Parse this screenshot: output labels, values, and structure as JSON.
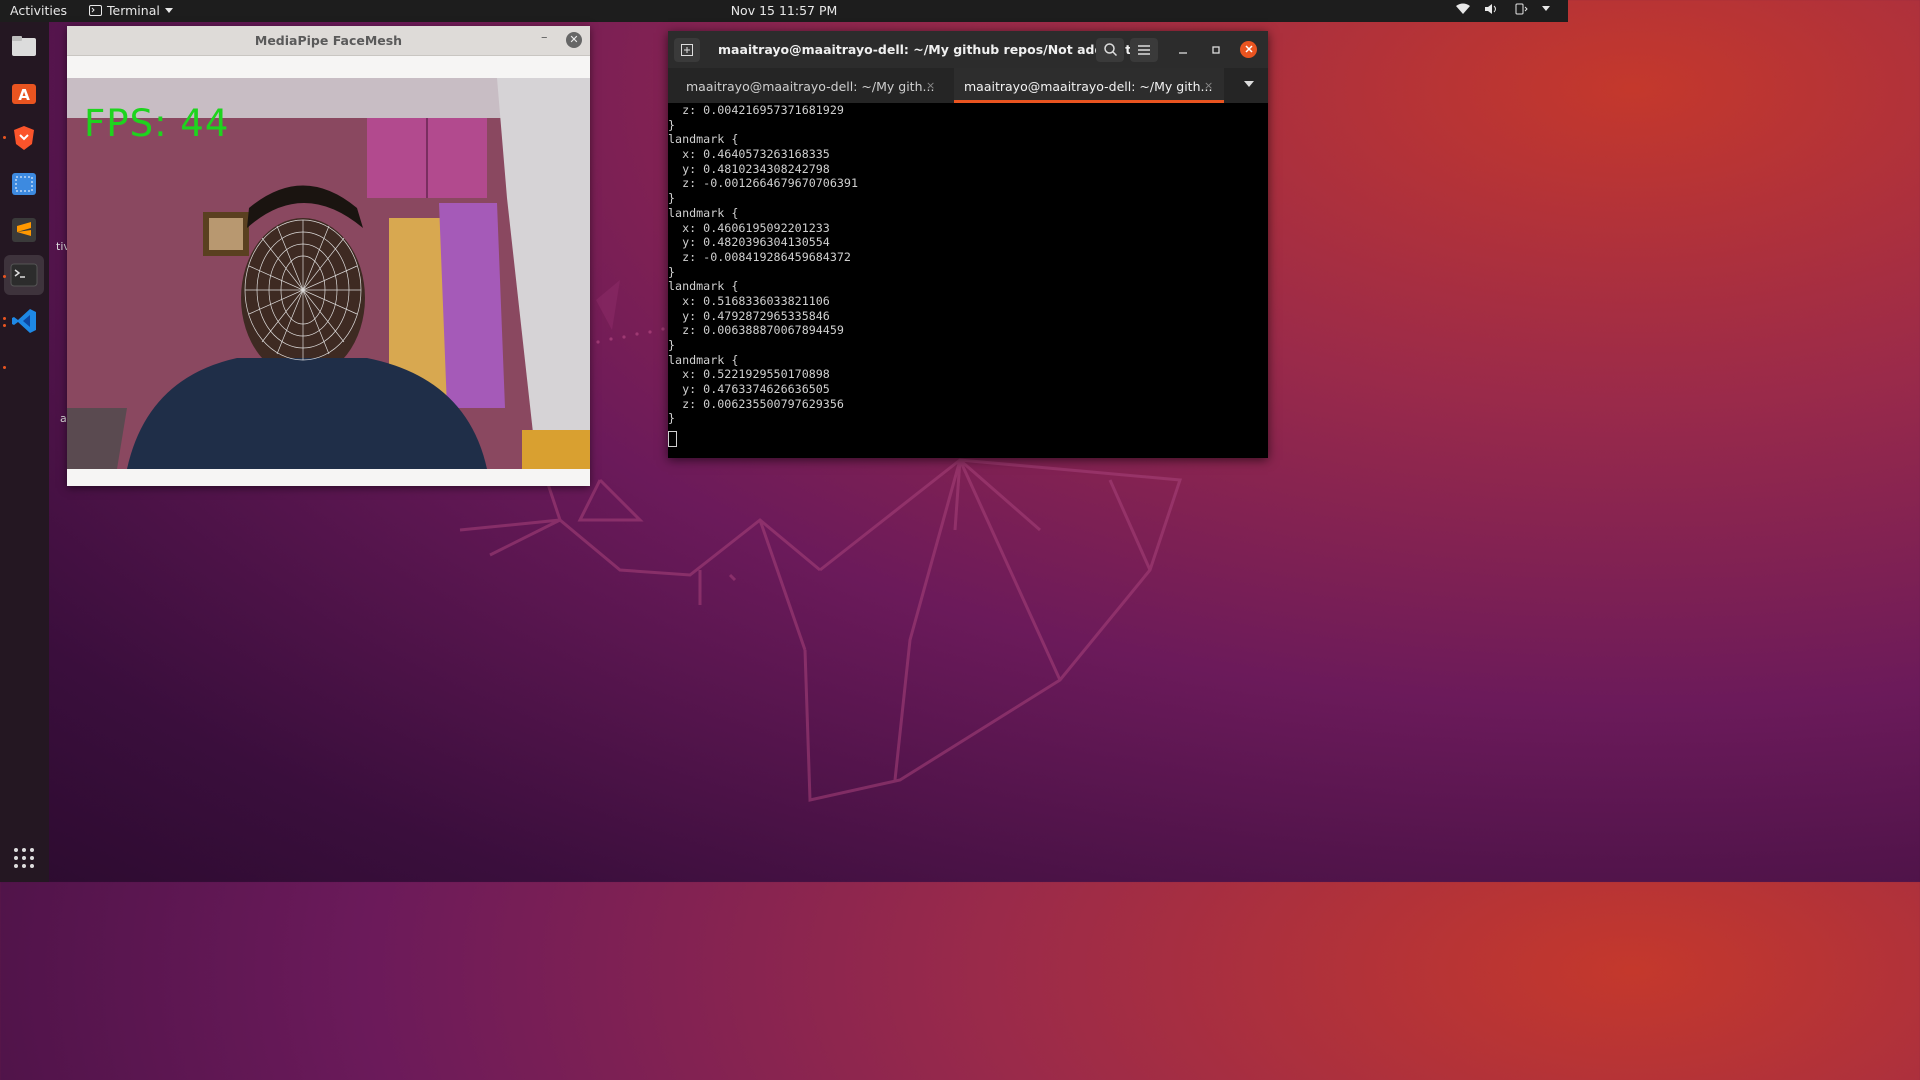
{
  "topbar": {
    "activities": "Activities",
    "app_menu": "Terminal",
    "clock": "Nov 15  11:57 PM"
  },
  "desktop": {
    "partial_label_1": "tiv",
    "partial_label_2": "a"
  },
  "dock": {
    "items": [
      {
        "name": "files-icon"
      },
      {
        "name": "software-icon"
      },
      {
        "name": "brave-browser-icon"
      },
      {
        "name": "screenshot-icon"
      },
      {
        "name": "sublime-text-icon"
      },
      {
        "name": "terminal-icon"
      },
      {
        "name": "vscode-icon"
      },
      {
        "name": "show-apps-icon"
      }
    ]
  },
  "facemesh_window": {
    "title": "MediaPipe FaceMesh",
    "minimize": "–",
    "close": "✕",
    "fps_text": "FPS: 44"
  },
  "terminal": {
    "title": "maaitrayo@maaitrayo-dell: ~/My github repos/Not added to...",
    "tabs": [
      {
        "label": "maaitrayo@maaitrayo-dell: ~/My gith...",
        "active": false
      },
      {
        "label": "maaitrayo@maaitrayo-dell: ~/My gith...",
        "active": true
      }
    ],
    "tab_close": "×",
    "lines": [
      "  z: 0.004216957371681929",
      "}",
      "landmark {",
      "  x: 0.4640573263168335",
      "  y: 0.4810234308242798",
      "  z: -0.0012664679670706391",
      "}",
      "landmark {",
      "  x: 0.4606195092201233",
      "  y: 0.4820396304130554",
      "  z: -0.008419286459684372",
      "}",
      "landmark {",
      "  x: 0.5168336033821106",
      "  y: 0.4792872965335846",
      "  z: 0.006388870067894459",
      "}",
      "landmark {",
      "  x: 0.5221929550170898",
      "  y: 0.4763374626636505",
      "  z: 0.006235500797629356",
      "}"
    ]
  }
}
